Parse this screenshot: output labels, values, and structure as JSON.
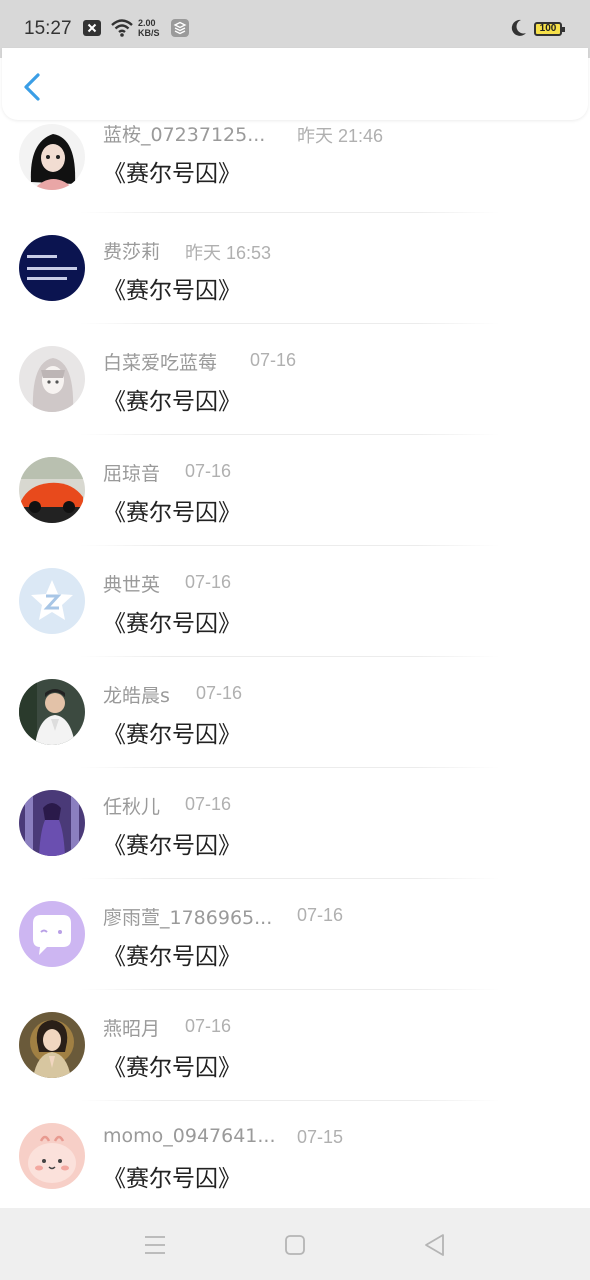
{
  "status_bar": {
    "time": "15:27",
    "speed_value": "2.00",
    "speed_unit": "KB/S",
    "battery": "100"
  },
  "header": {
    "back_icon": "chevron-left-icon"
  },
  "conversations": [
    {
      "name": "蓝桉_07237125...",
      "time": "昨天 21:46",
      "message": "《赛尔号囚》",
      "avatar": "anime-girl-dark-hair"
    },
    {
      "name": "费莎莉",
      "time": "昨天 16:53",
      "message": "《赛尔号囚》",
      "avatar": "dark-blue-text-image"
    },
    {
      "name": "白菜爱吃蓝莓",
      "time": "07-16",
      "message": "《赛尔号囚》",
      "avatar": "anime-sketch-girl"
    },
    {
      "name": "屈琼音",
      "time": "07-16",
      "message": "《赛尔号囚》",
      "avatar": "orange-sports-car"
    },
    {
      "name": "典世英",
      "time": "07-16",
      "message": "《赛尔号囚》",
      "avatar": "default-qq-penguin"
    },
    {
      "name": "龙皓晨s",
      "time": "07-16",
      "message": "《赛尔号囚》",
      "avatar": "man-white-suit"
    },
    {
      "name": "任秋儿",
      "time": "07-16",
      "message": "《赛尔号囚》",
      "avatar": "anime-purple-figure"
    },
    {
      "name": "廖雨萱_1786965...",
      "time": "07-16",
      "message": "《赛尔号囚》",
      "avatar": "purple-chat-bubble"
    },
    {
      "name": "燕昭月",
      "time": "07-16",
      "message": "《赛尔号囚》",
      "avatar": "woman-praying"
    },
    {
      "name": "momo_0947641...",
      "time": "07-15",
      "message": "《赛尔号囚》",
      "avatar": "pink-cartoon-creature"
    }
  ],
  "nav": {
    "menu_icon": "menu-icon",
    "home_icon": "home-square-icon",
    "back_icon": "back-triangle-icon"
  },
  "colors": {
    "accent": "#3a9ee6",
    "name": "#9a9a9a",
    "time": "#b0b0b0",
    "message": "#222222"
  }
}
